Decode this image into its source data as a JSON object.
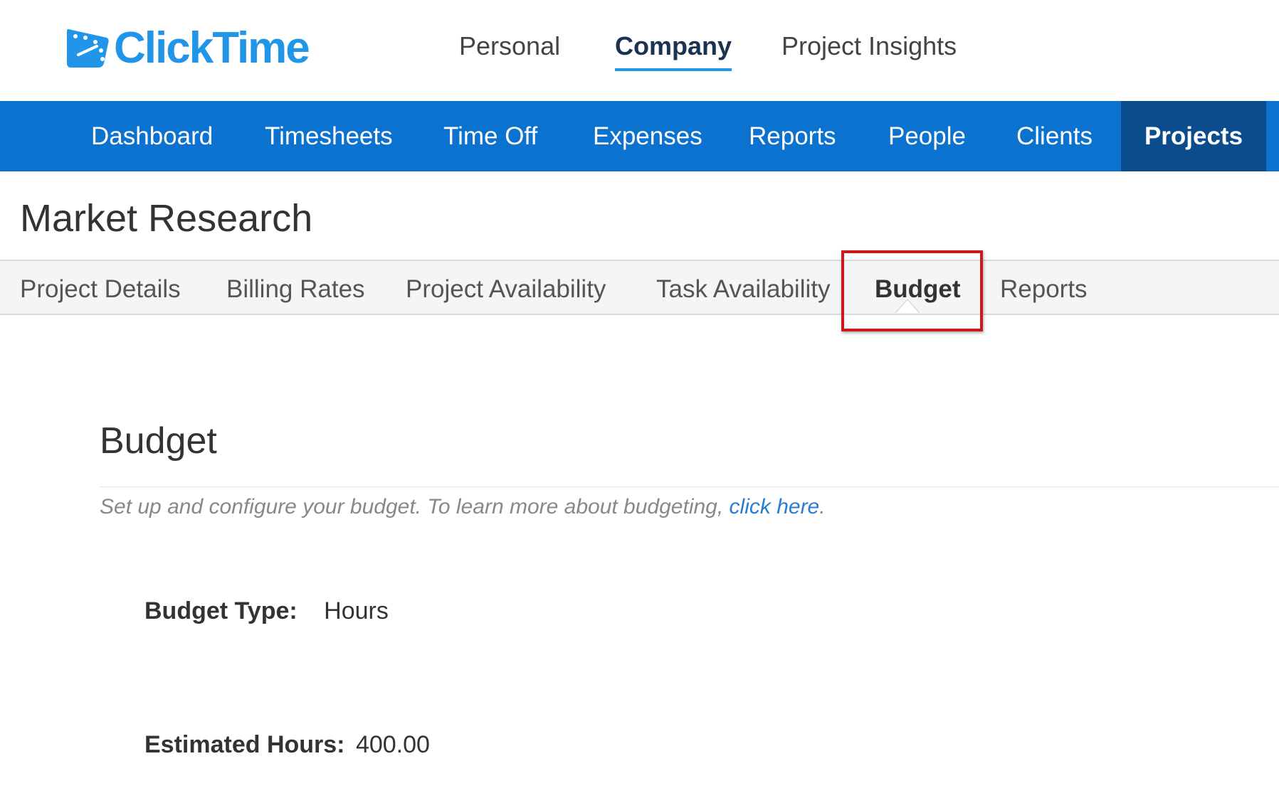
{
  "brand": {
    "name": "ClickTime",
    "color": "#2196e8"
  },
  "top_tabs": [
    {
      "label": "Personal",
      "active": false
    },
    {
      "label": "Company",
      "active": true
    },
    {
      "label": "Project Insights",
      "active": false
    }
  ],
  "main_nav": [
    {
      "label": "Dashboard",
      "active": false
    },
    {
      "label": "Timesheets",
      "active": false
    },
    {
      "label": "Time Off",
      "active": false
    },
    {
      "label": "Expenses",
      "active": false
    },
    {
      "label": "Reports",
      "active": false
    },
    {
      "label": "People",
      "active": false
    },
    {
      "label": "Clients",
      "active": false
    },
    {
      "label": "Projects",
      "active": true
    }
  ],
  "page": {
    "title": "Market Research"
  },
  "sub_tabs": [
    {
      "label": "Project Details",
      "active": false
    },
    {
      "label": "Billing Rates",
      "active": false
    },
    {
      "label": "Project Availability",
      "active": false
    },
    {
      "label": "Task Availability",
      "active": false
    },
    {
      "label": "Budget",
      "active": true
    },
    {
      "label": "Reports",
      "active": false
    }
  ],
  "budget": {
    "title": "Budget",
    "description": "Set up and configure your budget. To learn more about budgeting, ",
    "link_text": "click here",
    "description_end": ".",
    "fields": [
      {
        "label": "Budget Type:",
        "value": "Hours"
      },
      {
        "label": "Estimated Hours:",
        "value": "400.00"
      }
    ]
  },
  "colors": {
    "nav_bg": "#0b72cf",
    "nav_active_bg": "#0a4c8c",
    "highlight": "#cc1a1a",
    "link": "#2a7ccf"
  }
}
